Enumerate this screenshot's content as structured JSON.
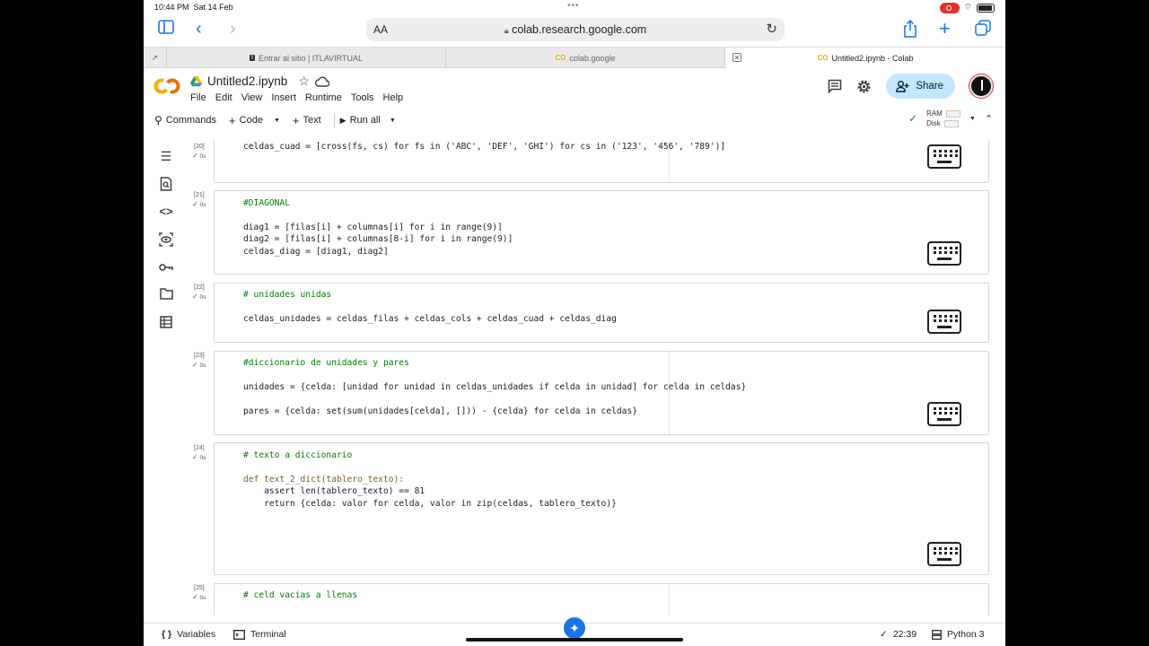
{
  "status_bar": {
    "time": "10:44 PM",
    "date": "Sat 14 Feb"
  },
  "browser": {
    "aa_label": "AA",
    "url": "colab.research.google.com",
    "tabs": [
      {
        "label": "Entrar al sitio | ITLAVIRTUAL",
        "favicon": "I"
      },
      {
        "label": "colab.google",
        "favicon": "CO"
      },
      {
        "label": "Untitled2.ipynb - Colab",
        "favicon": "CO"
      }
    ]
  },
  "notebook": {
    "title": "Untitled2.ipynb",
    "menu": [
      "File",
      "Edit",
      "View",
      "Insert",
      "Runtime",
      "Tools",
      "Help"
    ],
    "share_label": "Share"
  },
  "toolbar": {
    "commands": "Commands",
    "code": "Code",
    "text": "Text",
    "run_all": "Run all",
    "ram": "RAM",
    "disk": "Disk"
  },
  "cells": [
    {
      "number": "[20]",
      "time": "0s"
    },
    {
      "number": "[21]",
      "time": "0s"
    },
    {
      "number": "[22]",
      "time": "0s"
    },
    {
      "number": "[23]",
      "time": "0s"
    },
    {
      "number": "[24]",
      "time": "0s"
    },
    {
      "number": "[25]",
      "time": "0s"
    }
  ],
  "code": {
    "c20": [
      "celdas_cuad = [cross(fs, cs) for fs in ('ABC', 'DEF', 'GHI') for cs in ('123', '456', '789')]"
    ],
    "c21": [
      "#DIAGONAL",
      "",
      "diag1 = [filas[i] + columnas[i] for i in range(9)]",
      "diag2 = [filas[i] + columnas[8-i] for i in range(9)]",
      "celdas_diag = [diag1, diag2]"
    ],
    "c22": [
      "# unidades unidas",
      "",
      "celdas_unidades = celdas_filas + celdas_cols + celdas_cuad + celdas_diag"
    ],
    "c23": [
      "#diccionario de unidades y pares",
      "",
      "unidades = {celda: [unidad for unidad in celdas_unidades if celda in unidad] for celda in celdas}",
      "",
      "pares = {celda: set(sum(unidades[celda], [])) - {celda} for celda in celdas}"
    ],
    "c24": [
      "# texto a diccionario",
      "",
      "def text_2_dict(tablero_texto):",
      "    assert len(tablero_texto) == 81",
      "    return {celda: valor for celda, valor in zip(celdas, tablero_texto)}"
    ],
    "c25": [
      "# celd vacias a llenas"
    ]
  },
  "bottom_bar": {
    "variables": "Variables",
    "terminal": "Terminal",
    "exec_time": "22:39",
    "kernel": "Python 3"
  },
  "colors": {
    "accent": "#1a73e8",
    "share_bg": "#c2e7ff",
    "check": "#188038",
    "colab_orange": "#f9ab00"
  }
}
